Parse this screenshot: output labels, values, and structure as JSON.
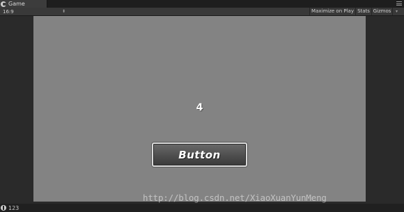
{
  "tab": {
    "label": "Game"
  },
  "toolbar": {
    "aspect": "16:9",
    "maximize_on_play": "Maximize on Play",
    "stats": "Stats",
    "gizmos": "Gizmos"
  },
  "game": {
    "counter": "4",
    "button_label": "Button"
  },
  "watermark": "http://blog.csdn.net/XiaoXuanYunMeng",
  "status": {
    "text": "123"
  },
  "icons": {
    "tab": "game-controller-icon",
    "window_menu": "menu-icon",
    "dropdown": "chevron-down-icon",
    "status": "console-log-icon"
  }
}
